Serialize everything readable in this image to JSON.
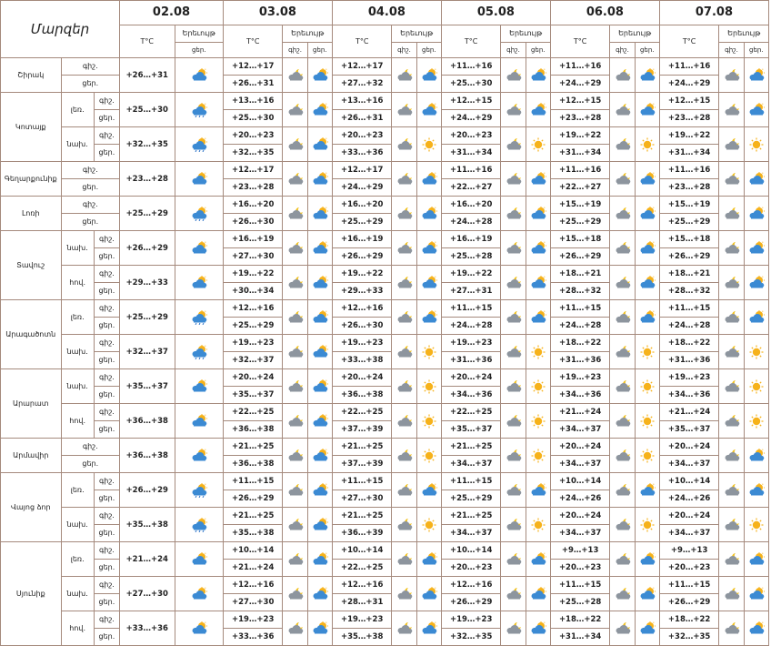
{
  "corner_label": "Մարզեր",
  "col_temp": "T°C",
  "col_precip": "Երեւույթ",
  "tod_night": "գիշ.",
  "tod_day": "ցեր.",
  "dates": [
    "02.08",
    "03.08",
    "04.08",
    "05.08",
    "06.08",
    "07.08"
  ],
  "regions": [
    {
      "name": "Շիրակ",
      "subs": [
        {
          "name": "",
          "temps": [
            [
              "",
              "+26…+31"
            ],
            [
              "+12…+17",
              "+26…+31"
            ],
            [
              "+12…+17",
              "+27…+32"
            ],
            [
              "+11…+16",
              "+25…+30"
            ],
            [
              "+11…+16",
              "+24…+29"
            ],
            [
              "+11…+16",
              "+24…+29"
            ]
          ]
        }
      ]
    },
    {
      "name": "Կոտայք",
      "subs": [
        {
          "name": "լեռ.",
          "temps": [
            [
              "",
              "+25…+30"
            ],
            [
              "+13…+16",
              "+25…+30"
            ],
            [
              "+13…+16",
              "+26…+31"
            ],
            [
              "+12…+15",
              "+24…+29"
            ],
            [
              "+12…+15",
              "+23…+28"
            ],
            [
              "+12…+15",
              "+23…+28"
            ]
          ]
        },
        {
          "name": "նախ.",
          "temps": [
            [
              "",
              "+32…+35"
            ],
            [
              "+20…+23",
              "+32…+35"
            ],
            [
              "+20…+23",
              "+33…+36"
            ],
            [
              "+20…+23",
              "+31…+34"
            ],
            [
              "+19…+22",
              "+31…+34"
            ],
            [
              "+19…+22",
              "+31…+34"
            ]
          ]
        }
      ]
    },
    {
      "name": "Գեղարքունիք",
      "subs": [
        {
          "name": "",
          "temps": [
            [
              "",
              "+23…+28"
            ],
            [
              "+12…+17",
              "+23…+28"
            ],
            [
              "+12…+17",
              "+24…+29"
            ],
            [
              "+11…+16",
              "+22…+27"
            ],
            [
              "+11…+16",
              "+22…+27"
            ],
            [
              "+11…+16",
              "+23…+28"
            ]
          ]
        }
      ]
    },
    {
      "name": "Լոռի",
      "subs": [
        {
          "name": "",
          "temps": [
            [
              "",
              "+25…+29"
            ],
            [
              "+16…+20",
              "+26…+30"
            ],
            [
              "+16…+20",
              "+25…+29"
            ],
            [
              "+16…+20",
              "+24…+28"
            ],
            [
              "+15…+19",
              "+25…+29"
            ],
            [
              "+15…+19",
              "+25…+29"
            ]
          ]
        }
      ]
    },
    {
      "name": "Տավուշ",
      "subs": [
        {
          "name": "նախ.",
          "temps": [
            [
              "",
              "+26…+29"
            ],
            [
              "+16…+19",
              "+27…+30"
            ],
            [
              "+16…+19",
              "+26…+29"
            ],
            [
              "+16…+19",
              "+25…+28"
            ],
            [
              "+15…+18",
              "+26…+29"
            ],
            [
              "+15…+18",
              "+26…+29"
            ]
          ]
        },
        {
          "name": "հով.",
          "temps": [
            [
              "",
              "+29…+33"
            ],
            [
              "+19…+22",
              "+30…+34"
            ],
            [
              "+19…+22",
              "+29…+33"
            ],
            [
              "+19…+22",
              "+27…+31"
            ],
            [
              "+18…+21",
              "+28…+32"
            ],
            [
              "+18…+21",
              "+28…+32"
            ]
          ]
        }
      ]
    },
    {
      "name": "Արագածոտն",
      "subs": [
        {
          "name": "լեռ.",
          "temps": [
            [
              "",
              "+25…+29"
            ],
            [
              "+12…+16",
              "+25…+29"
            ],
            [
              "+12…+16",
              "+26…+30"
            ],
            [
              "+11…+15",
              "+24…+28"
            ],
            [
              "+11…+15",
              "+24…+28"
            ],
            [
              "+11…+15",
              "+24…+28"
            ]
          ]
        },
        {
          "name": "նախ.",
          "temps": [
            [
              "",
              "+32…+37"
            ],
            [
              "+19…+23",
              "+32…+37"
            ],
            [
              "+19…+23",
              "+33…+38"
            ],
            [
              "+19…+23",
              "+31…+36"
            ],
            [
              "+18…+22",
              "+31…+36"
            ],
            [
              "+18…+22",
              "+31…+36"
            ]
          ]
        }
      ]
    },
    {
      "name": "Արարատ",
      "subs": [
        {
          "name": "նախ.",
          "temps": [
            [
              "",
              "+35…+37"
            ],
            [
              "+20…+24",
              "+35…+37"
            ],
            [
              "+20…+24",
              "+36…+38"
            ],
            [
              "+20…+24",
              "+34…+36"
            ],
            [
              "+19…+23",
              "+34…+36"
            ],
            [
              "+19…+23",
              "+34…+36"
            ]
          ]
        },
        {
          "name": "հով.",
          "temps": [
            [
              "",
              "+36…+38"
            ],
            [
              "+22…+25",
              "+36…+38"
            ],
            [
              "+22…+25",
              "+37…+39"
            ],
            [
              "+22…+25",
              "+35…+37"
            ],
            [
              "+21…+24",
              "+34…+37"
            ],
            [
              "+21…+24",
              "+35…+37"
            ]
          ]
        }
      ]
    },
    {
      "name": "Արմավիր",
      "subs": [
        {
          "name": "",
          "temps": [
            [
              "",
              "+36…+38"
            ],
            [
              "+21…+25",
              "+36…+38"
            ],
            [
              "+21…+25",
              "+37…+39"
            ],
            [
              "+21…+25",
              "+34…+37"
            ],
            [
              "+20…+24",
              "+34…+37"
            ],
            [
              "+20…+24",
              "+34…+37"
            ]
          ]
        }
      ]
    },
    {
      "name": "Վայոց ձոր",
      "subs": [
        {
          "name": "լեռ.",
          "temps": [
            [
              "",
              "+26…+29"
            ],
            [
              "+11…+15",
              "+26…+29"
            ],
            [
              "+11…+15",
              "+27…+30"
            ],
            [
              "+11…+15",
              "+25…+29"
            ],
            [
              "+10…+14",
              "+24…+26"
            ],
            [
              "+10…+14",
              "+24…+26"
            ]
          ]
        },
        {
          "name": "նախ.",
          "temps": [
            [
              "",
              "+35…+38"
            ],
            [
              "+21…+25",
              "+35…+38"
            ],
            [
              "+21…+25",
              "+36…+39"
            ],
            [
              "+21…+25",
              "+34…+37"
            ],
            [
              "+20…+24",
              "+34…+37"
            ],
            [
              "+20…+24",
              "+34…+37"
            ]
          ]
        }
      ]
    },
    {
      "name": "Սյունիք",
      "subs": [
        {
          "name": "լեռ.",
          "temps": [
            [
              "",
              "+21…+24"
            ],
            [
              "+10…+14",
              "+21…+24"
            ],
            [
              "+10…+14",
              "+22…+25"
            ],
            [
              "+10…+14",
              "+20…+23"
            ],
            [
              "+9…+13",
              "+20…+23"
            ],
            [
              "+9…+13",
              "+20…+23"
            ]
          ]
        },
        {
          "name": "նախ.",
          "temps": [
            [
              "",
              "+27…+30"
            ],
            [
              "+12…+16",
              "+27…+30"
            ],
            [
              "+12…+16",
              "+28…+31"
            ],
            [
              "+12…+16",
              "+26…+29"
            ],
            [
              "+11…+15",
              "+25…+28"
            ],
            [
              "+11…+15",
              "+26…+29"
            ]
          ]
        },
        {
          "name": "հով.",
          "temps": [
            [
              "",
              "+33…+36"
            ],
            [
              "+19…+23",
              "+33…+36"
            ],
            [
              "+19…+23",
              "+35…+38"
            ],
            [
              "+19…+23",
              "+32…+35"
            ],
            [
              "+18…+22",
              "+31…+34"
            ],
            [
              "+18…+22",
              "+32…+35"
            ]
          ]
        }
      ]
    }
  ]
}
